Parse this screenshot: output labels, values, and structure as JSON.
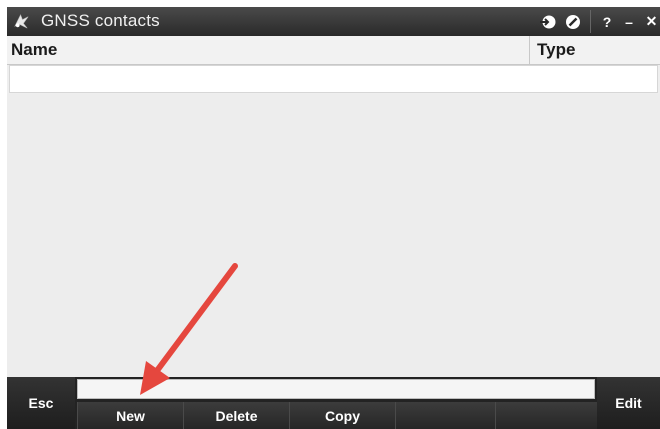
{
  "window": {
    "title": "GNSS contacts",
    "icons": [
      "app-logo-icon",
      "connect-icon",
      "no-entry-icon"
    ],
    "controls": {
      "help": "?",
      "minimize": "–",
      "close": "✕"
    }
  },
  "list": {
    "columns": {
      "name": "Name",
      "type": "Type"
    },
    "rows": []
  },
  "softkeys": {
    "esc": "Esc",
    "edit": "Edit",
    "new": "New",
    "delete": "Delete",
    "copy": "Copy",
    "empty4": "",
    "empty5": ""
  },
  "colors": {
    "titlebar": "#2a2a2a",
    "background": "#eeeeee",
    "softkey_bar": "#232323",
    "annotation_arrow": "#e5473e"
  }
}
